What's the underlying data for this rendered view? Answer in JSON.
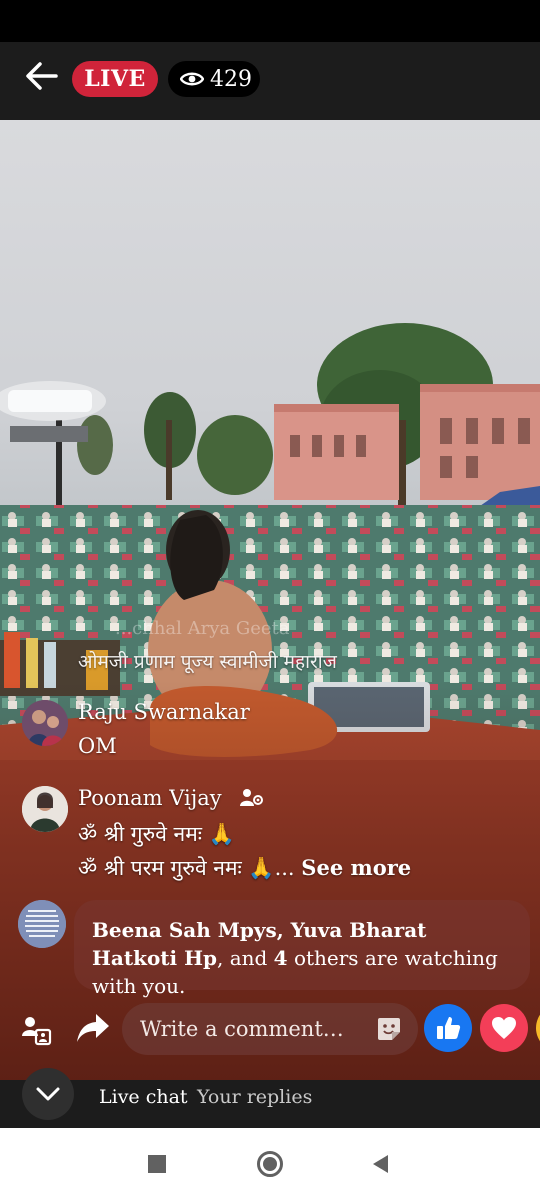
{
  "header": {
    "live_label": "LIVE",
    "viewer_count": "429"
  },
  "video": {
    "banner_ghost_text": "...chhal Arya Geeta",
    "banner_text": "ओमजी प्रणाम पूज्य स्वामीजी महाराज"
  },
  "comments": [
    {
      "author": "Raju Swarnakar",
      "lines": [
        "OM"
      ]
    },
    {
      "author": "Poonam Vijay",
      "lines": [
        "ॐ श्री गुरुवे नमः 🙏",
        "ॐ श्री परम गुरुवे नमः 🙏..."
      ],
      "see_more": "See more"
    }
  ],
  "watching": {
    "names": "Beena Sah Mpys, Yuva Bharat Hatkoti Hp",
    "connector": ", and ",
    "count": "4",
    "suffix": " others are watching with you."
  },
  "composer": {
    "placeholder": "Write a comment…"
  },
  "tabs": {
    "live_chat": "Live chat",
    "your_replies": "Your replies"
  },
  "colors": {
    "live_red": "#d0243a",
    "like_blue": "#1877f2",
    "love_red": "#f33e58"
  },
  "icons": [
    "back-arrow-icon",
    "eye-icon",
    "gear-icon",
    "share-icon",
    "sticker-icon",
    "like-icon",
    "heart-icon",
    "chevron-down-icon",
    "nav-recents-icon",
    "nav-home-icon",
    "nav-back-icon"
  ]
}
